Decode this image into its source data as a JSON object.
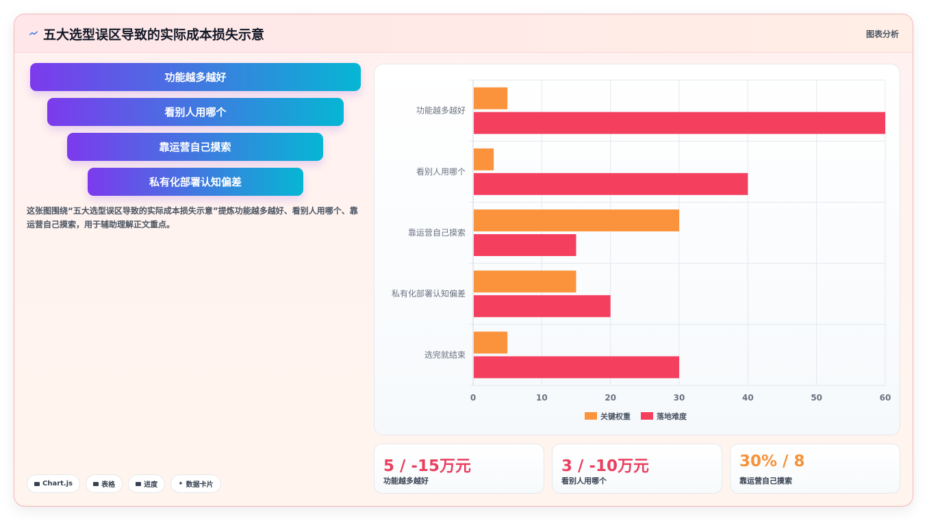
{
  "header": {
    "title": "五大选型误区导致的实际成本损失示意",
    "tag": "图表分析",
    "logo_icon": "line-chart-icon"
  },
  "pills": [
    {
      "label": "功能越多越好"
    },
    {
      "label": "看别人用哪个"
    },
    {
      "label": "靠运营自己摸索"
    },
    {
      "label": "私有化部署认知偏差"
    }
  ],
  "description": "这张图围绕“五大选型误区导致的实际成本损失示意”提炼功能越多越好、看别人用哪个、靠运营自己摸索，用于辅助理解正文重点。",
  "chips": [
    {
      "icon": "chart-icon",
      "label": "Chart.js"
    },
    {
      "icon": "table-icon",
      "label": "表格"
    },
    {
      "icon": "progress-icon",
      "label": "进度"
    },
    {
      "icon": "sparkle-icon",
      "label": "数据卡片"
    }
  ],
  "stats": [
    {
      "value": "5 / -15万元",
      "label": "功能越多越好",
      "color": "#e8405f"
    },
    {
      "value": "3 / -10万元",
      "label": "看别人用哪个",
      "color": "#e8405f"
    },
    {
      "value": "30% / 8",
      "label": "靠运营自己摸索",
      "color": "#f7923a"
    }
  ],
  "chart_data": {
    "type": "bar",
    "orientation": "horizontal",
    "categories": [
      "功能越多越好",
      "看别人用哪个",
      "靠运营自己摸索",
      "私有化部署认知偏差",
      "选完就结束"
    ],
    "series": [
      {
        "name": "关键权重",
        "values": [
          5,
          3,
          30,
          15,
          5
        ],
        "color": "#fb923c"
      },
      {
        "name": "落地难度",
        "values": [
          60,
          40,
          15,
          20,
          30
        ],
        "color": "#f43f5e"
      }
    ],
    "xlim": [
      0,
      60
    ],
    "xticks": [
      0,
      10,
      20,
      30,
      40,
      50,
      60
    ],
    "grid": true,
    "legend": "bottom"
  }
}
